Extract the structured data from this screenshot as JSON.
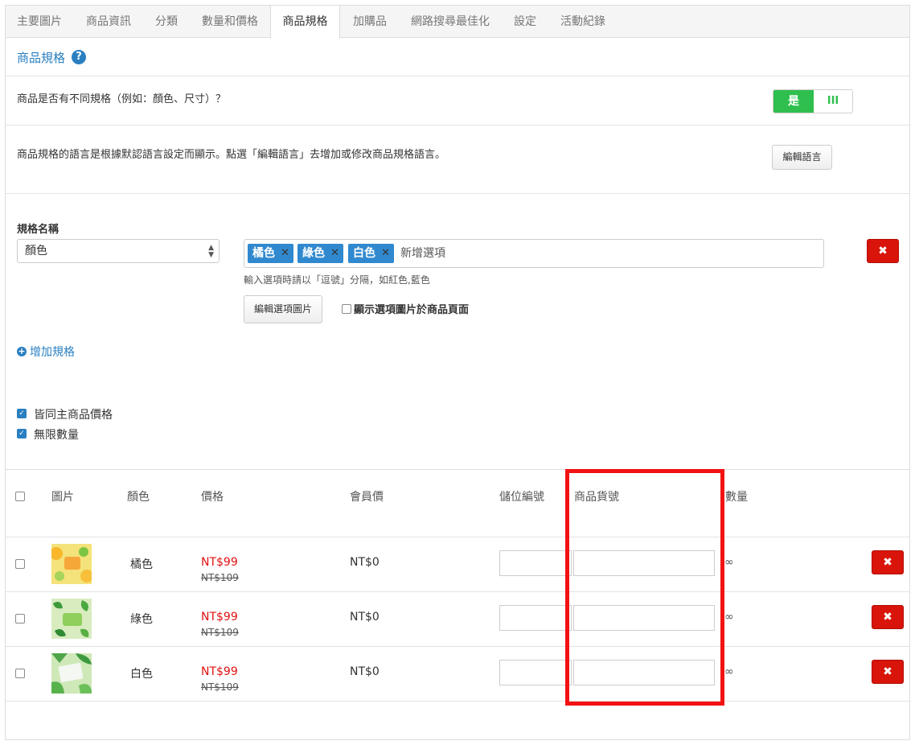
{
  "tabs": [
    {
      "label": "主要圖片",
      "active": false
    },
    {
      "label": "商品資訊",
      "active": false
    },
    {
      "label": "分類",
      "active": false
    },
    {
      "label": "數量和價格",
      "active": false
    },
    {
      "label": "商品規格",
      "active": true
    },
    {
      "label": "加購品",
      "active": false
    },
    {
      "label": "網路搜尋最佳化",
      "active": false
    },
    {
      "label": "設定",
      "active": false
    },
    {
      "label": "活動紀錄",
      "active": false
    }
  ],
  "section": {
    "title": "商品規格",
    "help_icon": "?"
  },
  "variants_question": {
    "label": "商品是否有不同規格（例如：顏色、尺寸）？",
    "toggle_on": "是",
    "toggle_off": "III"
  },
  "language": {
    "note": "商品規格的語言是根據默認語言設定而顯示。點選「編輯語言」去增加或修改商品規格語言。",
    "button": "編輯語言"
  },
  "spec": {
    "name_label": "規格名稱",
    "selected": "顏色",
    "options": [
      {
        "label": "橘色",
        "remove": "✕"
      },
      {
        "label": "綠色",
        "remove": "✕"
      },
      {
        "label": "白色",
        "remove": "✕"
      }
    ],
    "add_option_placeholder": "新增選項",
    "hint": "輸入選項時請以「逗號」分隔，如紅色,藍色",
    "edit_images_button": "編輯選項圖片",
    "show_images_label": "顯示選項圖片於商品頁面",
    "delete_icon": "✖"
  },
  "add_spec": {
    "icon": "+",
    "label": "增加規格"
  },
  "options_checkboxes": [
    {
      "label": "皆同主商品價格",
      "checked": true
    },
    {
      "label": "無限數量",
      "checked": true
    }
  ],
  "table": {
    "headers": {
      "image": "圖片",
      "color": "顏色",
      "price": "價格",
      "member_price": "會員價",
      "storage_code": "儲位編號",
      "sku": "商品貨號",
      "quantity": "數量"
    },
    "rows": [
      {
        "color": "橘色",
        "price": "NT$99",
        "original_price": "NT$109",
        "member_price": "NT$0",
        "quantity": "∞",
        "delete": "✖"
      },
      {
        "color": "綠色",
        "price": "NT$99",
        "original_price": "NT$109",
        "member_price": "NT$0",
        "quantity": "∞",
        "delete": "✖"
      },
      {
        "color": "白色",
        "price": "NT$99",
        "original_price": "NT$109",
        "member_price": "NT$0",
        "quantity": "∞",
        "delete": "✖"
      }
    ]
  },
  "colors": {
    "accent": "#2a7fc1",
    "toggle_green": "#2fbf4f",
    "danger": "#d9140a",
    "price_red": "#e01010",
    "highlight_box": "#f21212"
  }
}
